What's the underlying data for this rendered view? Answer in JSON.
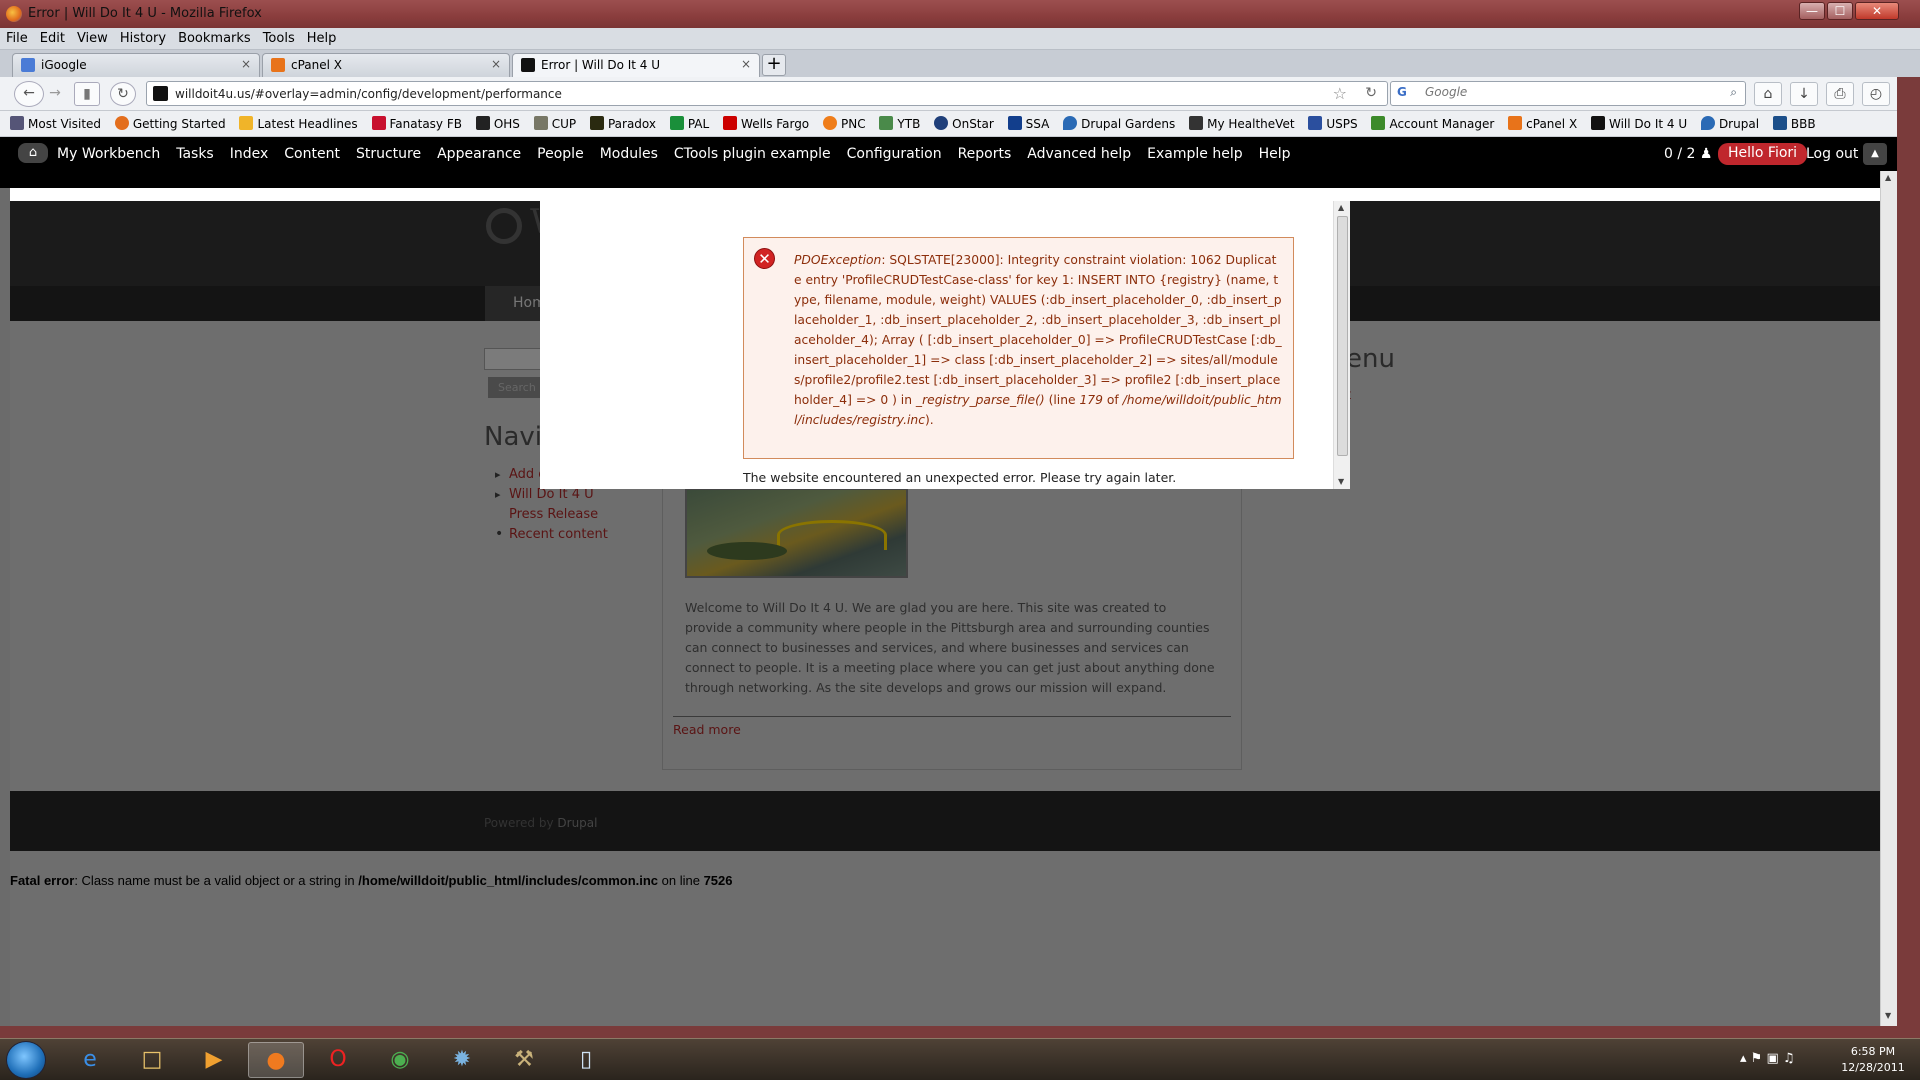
{
  "window": {
    "title": "Error | Will Do It 4 U - Mozilla Firefox",
    "minimize": "—",
    "maximize": "☐",
    "close": "✕"
  },
  "menu": [
    "File",
    "Edit",
    "View",
    "History",
    "Bookmarks",
    "Tools",
    "Help"
  ],
  "tabs": [
    {
      "label": "iGoogle",
      "icon_color": "#4a7bd6"
    },
    {
      "label": "cPanel X",
      "icon_color": "#e8731a"
    },
    {
      "label": "Error | Will Do It 4 U",
      "icon_color": "#111111"
    }
  ],
  "tab_close": "×",
  "new_tab": "+",
  "nav": {
    "url": "willdoit4u.us/#overlay=admin/config/development/performance",
    "search_placeholder": "Google",
    "back": "←",
    "forward": "→",
    "star": "☆",
    "reload": "↻",
    "search_engine": "G",
    "magnifier": "⌕",
    "home": "⌂",
    "downloads": "↓",
    "print": "⎙",
    "history": "◴"
  },
  "bookmarks": [
    "Most Visited",
    "Getting Started",
    "Latest Headlines",
    "Fanatasy FB",
    "OHS",
    "CUP",
    "Paradox",
    "PAL",
    "Wells Fargo",
    "PNC",
    "YTB",
    "OnStar",
    "SSA",
    "Drupal Gardens",
    "My HealtheVet",
    "USPS",
    "Account Manager",
    "cPanel X",
    "Will Do It 4 U",
    "Drupal",
    "BBB"
  ],
  "toolbar": {
    "home_icon": "⌂",
    "links": [
      "My Workbench",
      "Tasks",
      "Index",
      "Content",
      "Structure",
      "Appearance",
      "People",
      "Modules",
      "CTools plugin example",
      "Configuration",
      "Reports",
      "Advanced help",
      "Example help",
      "Help"
    ],
    "counter": "0 / 2",
    "hello": "Hello Fiori",
    "logout": "Log out",
    "collapse": "▲"
  },
  "site": {
    "logo_letter": "W",
    "nav_home": "Home",
    "search_button": "Search",
    "navigation_heading": "Navi",
    "nav_links": [
      "Add c",
      "Will Do It 4 U Press Release",
      "Recent content"
    ],
    "right_heading": "enu",
    "right_link": "t",
    "welcome": "Welcome to Will Do It 4 U. We are glad you are here. This site was created to provide a community where people in the Pittsburgh area and surrounding counties can connect to businesses and services, and where businesses and services can connect to people. It is a meeting place where you can get just about anything done through networking. As the site develops and grows our mission will expand.",
    "read_more": "Read more",
    "powered_by": "Powered by",
    "drupal": "Drupal"
  },
  "error": {
    "exception": "PDOException",
    "message_1": ": SQLSTATE[23000]: Integrity constraint violation: 1062 Duplicate entry 'ProfileCRUDTestCase-class' for key 1: INSERT INTO {registry} (name, type, filename, module, weight) VALUES (:db_insert_placeholder_0, :db_insert_placeholder_1, :db_insert_placeholder_2, :db_insert_placeholder_3, :db_insert_placeholder_4); Array ( [:db_insert_placeholder_0] => ProfileCRUDTestCase [:db_insert_placeholder_1] => class [:db_insert_placeholder_2] => sites/all/modules/profile2/profile2.test [:db_insert_placeholder_3] => profile2 [:db_insert_placeholder_4] => 0 ) in ",
    "function": "_registry_parse_file()",
    "message_2": " (line ",
    "line": "179",
    "message_3": " of ",
    "file": "/home/willdoit/public_html/includes/registry.inc",
    "message_4": ").",
    "unexpected": "The website encountered an unexpected error. Please try again later.",
    "icon": "✕"
  },
  "fatal": {
    "label": "Fatal error",
    "text_1": ": Class name must be a valid object or a string in ",
    "path": "/home/willdoit/public_html/includes/common.inc",
    "text_2": " on line ",
    "line": "7526"
  },
  "taskbar": {
    "tray_icons": "▴  ⚑  ▣  ♫",
    "time": "6:58 PM",
    "date": "12/28/2011"
  }
}
